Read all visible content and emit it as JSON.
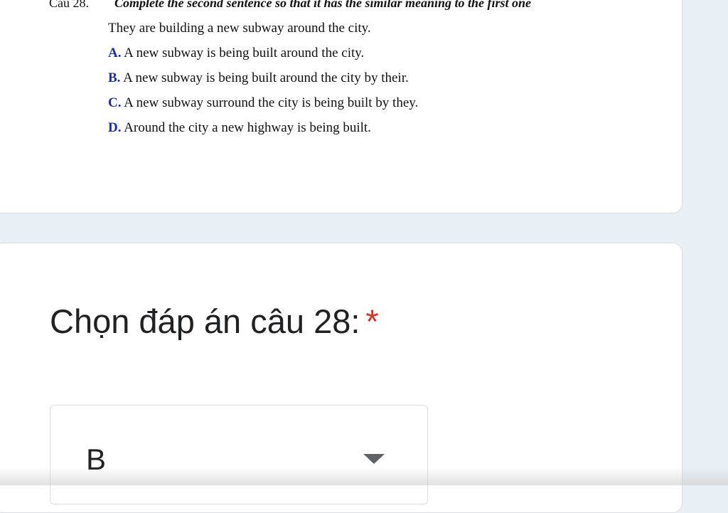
{
  "question_card": {
    "number_label": "Câu 28.",
    "instruction": "Complete the second sentence so that it has the similar meaning to the first one",
    "stem": "They are building a new subway around the city.",
    "options": [
      {
        "letter": "A.",
        "text": " A new subway is being built around the city."
      },
      {
        "letter": "B.",
        "text": " A new subway is being built around the city by their."
      },
      {
        "letter": "C.",
        "text": " A new subway surround the city is being built by they."
      },
      {
        "letter": "D.",
        "text": " Around the city a new highway is being built."
      }
    ]
  },
  "answer_card": {
    "title": "Chọn đáp án câu 28:",
    "required_marker": "*",
    "dropdown": {
      "selected_value": "B",
      "icon": "dropdown-arrow-icon"
    }
  },
  "colors": {
    "page_background": "#e8f0f6",
    "card_background": "#ffffff",
    "option_letter": "#1a2ea8",
    "required": "#d93025",
    "text": "#202124"
  }
}
